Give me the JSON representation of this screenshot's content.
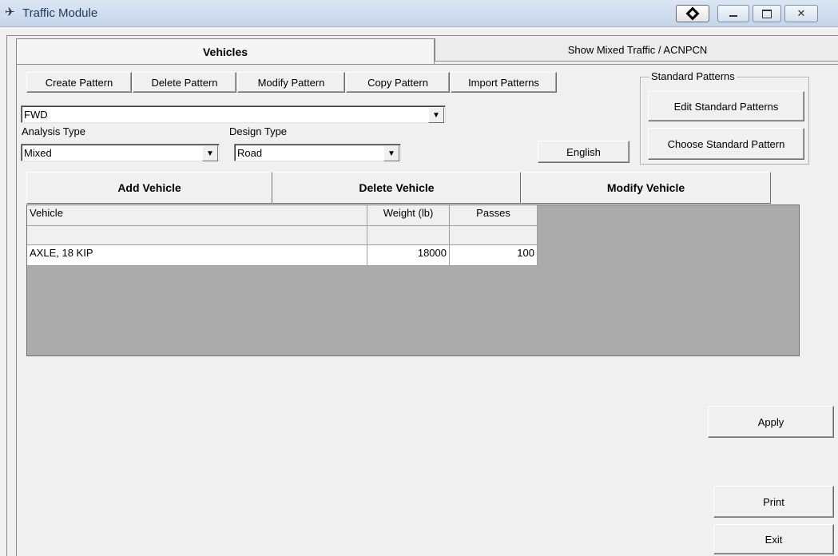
{
  "window": {
    "title": "Traffic Module"
  },
  "tabs": {
    "vehicles": "Vehicles",
    "mixed": "Show Mixed Traffic / ACNPCN"
  },
  "toolbar": {
    "create": "Create Pattern",
    "delete": "Delete Pattern",
    "modify": "Modify Pattern",
    "copy": "Copy Pattern",
    "import": "Import Patterns"
  },
  "standard_patterns": {
    "group_label": "Standard Patterns",
    "edit": "Edit Standard Patterns",
    "choose": "Choose Standard Pattern"
  },
  "pattern_select": {
    "value": "FWD"
  },
  "analysis_type": {
    "label": "Analysis Type",
    "value": "Mixed"
  },
  "design_type": {
    "label": "Design  Type",
    "value": "Road"
  },
  "units_button": "English",
  "vehicle_actions": {
    "add": "Add Vehicle",
    "delete": "Delete Vehicle",
    "modify": "Modify Vehicle"
  },
  "table": {
    "headers": [
      "Vehicle",
      "Weight (lb)",
      "Passes"
    ],
    "rows": [
      [
        "",
        "",
        ""
      ],
      [
        "AXLE, 18 KIP",
        "18000",
        "100"
      ]
    ]
  },
  "side_buttons": {
    "apply": "Apply",
    "print": "Print",
    "exit": "Exit"
  }
}
